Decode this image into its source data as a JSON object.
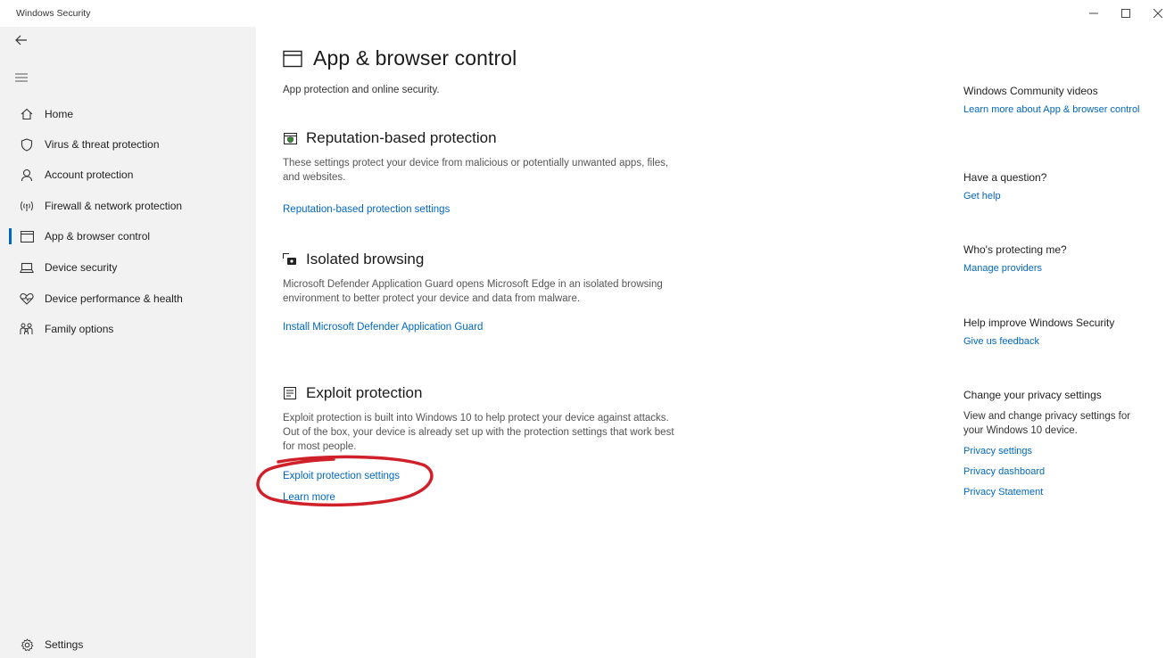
{
  "window": {
    "title": "Windows Security",
    "controls": [
      "minimize",
      "maximize",
      "close"
    ]
  },
  "sidebar": {
    "back_icon": "back-arrow-icon",
    "menu_icon": "hamburger-menu-icon",
    "items": [
      {
        "label": "Home",
        "icon": "home-icon",
        "selected": false
      },
      {
        "label": "Virus & threat protection",
        "icon": "shield-icon",
        "selected": false
      },
      {
        "label": "Account protection",
        "icon": "person-icon",
        "selected": false
      },
      {
        "label": "Firewall & network protection",
        "icon": "wifi-antenna-icon",
        "selected": false
      },
      {
        "label": "App & browser control",
        "icon": "app-window-icon",
        "selected": true
      },
      {
        "label": "Device security",
        "icon": "laptop-icon",
        "selected": false
      },
      {
        "label": "Device performance & health",
        "icon": "heart-pulse-icon",
        "selected": false
      },
      {
        "label": "Family options",
        "icon": "family-icon",
        "selected": false
      }
    ],
    "settings": {
      "label": "Settings",
      "icon": "gear-icon"
    }
  },
  "main": {
    "title": "App & browser control",
    "subtitle": "App protection and online security.",
    "sections": [
      {
        "title": "Reputation-based protection",
        "icon": "reputation-icon",
        "description": "These settings protect your device from malicious or potentially unwanted apps, files, and websites.",
        "links": [
          "Reputation-based protection settings"
        ]
      },
      {
        "title": "Isolated browsing",
        "icon": "isolated-browsing-icon",
        "description": "Microsoft Defender Application Guard opens Microsoft Edge in an isolated browsing environment to better protect your device and data from malware.",
        "links": [
          "Install Microsoft Defender Application Guard"
        ]
      },
      {
        "title": "Exploit protection",
        "icon": "exploit-protection-icon",
        "description": "Exploit protection is built into Windows 10 to help protect your device against attacks.  Out of the box, your device is already set up with the protection settings that work best for most people.",
        "links": [
          "Exploit protection settings",
          "Learn more"
        ]
      }
    ]
  },
  "rightpanel": {
    "community": {
      "heading": "Windows Community videos",
      "link": "Learn more about App & browser control"
    },
    "question": {
      "heading": "Have a question?",
      "link": "Get help"
    },
    "protecting": {
      "heading": "Who's protecting me?",
      "link": "Manage providers"
    },
    "improve": {
      "heading": "Help improve Windows Security",
      "link": "Give us feedback"
    },
    "privacy": {
      "heading": "Change your privacy settings",
      "text": "View and change privacy settings for your Windows 10 device.",
      "links": [
        "Privacy settings",
        "Privacy dashboard",
        "Privacy Statement"
      ]
    }
  },
  "colors": {
    "accent": "#0067c0",
    "sidebar_bg": "#f2f2f2",
    "annotation": "#d0212a"
  }
}
